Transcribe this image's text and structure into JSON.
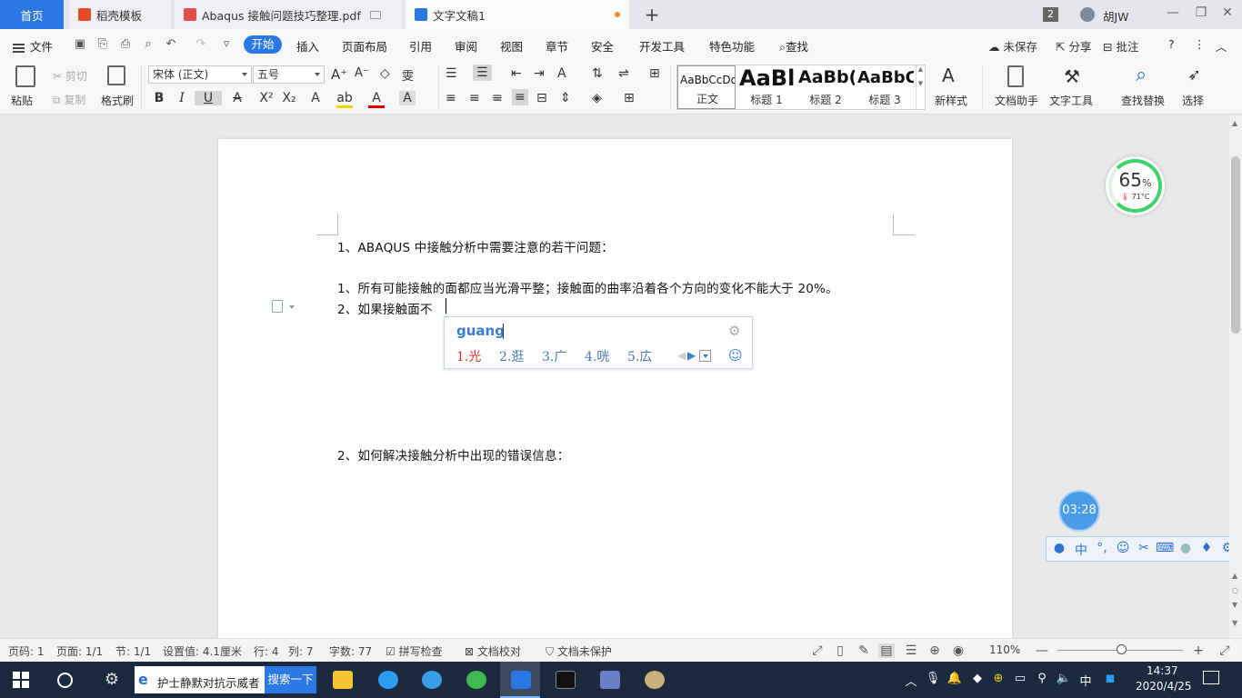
{
  "tabs": {
    "home": "首页",
    "items": [
      {
        "label": "稻壳模板"
      },
      {
        "label": "Abaqus 接触问题技巧整理.pdf"
      },
      {
        "label": "文字文稿1"
      }
    ],
    "add": "+",
    "window_count": "2",
    "user": "胡JW"
  },
  "menu": {
    "file": "文件",
    "items": [
      "开始",
      "插入",
      "页面布局",
      "引用",
      "审阅",
      "视图",
      "章节",
      "安全",
      "开发工具",
      "特色功能"
    ],
    "search": "查找",
    "right": {
      "unsaved": "未保存",
      "share": "分享",
      "comment": "批注"
    }
  },
  "ribbon": {
    "paste": "粘贴",
    "cut": "剪切",
    "copy": "复制",
    "format_painter": "格式刷",
    "font_name": "宋体 (正文)",
    "font_size": "五号",
    "styles": [
      {
        "preview": "AaBbCcDd",
        "label": "正文"
      },
      {
        "preview": "AaBl",
        "label": "标题 1"
      },
      {
        "preview": "AaBb(",
        "label": "标题 2"
      },
      {
        "preview": "AaBbC",
        "label": "标题 3"
      }
    ],
    "new_style": "新样式",
    "doc_assistant": "文档助手",
    "text_tools": "文字工具",
    "find_replace": "查找替换",
    "select": "选择"
  },
  "document": {
    "lines": [
      "1、ABAQUS 中接触分析中需要注意的若干问题：",
      "1、所有可能接触的面都应当光滑平整；接触面的曲率沿着各个方向的变化不能大于 20%。",
      "2、如果接触面不",
      "2、如何解决接触分析中出现的错误信息："
    ]
  },
  "ime": {
    "input": "guang",
    "candidates": [
      "1.光",
      "2.逛",
      "3.广",
      "4.咣",
      "5.広"
    ]
  },
  "widgets": {
    "cpu_percent": "65",
    "cpu_percent_unit": "%",
    "cpu_temp": "71°C",
    "timer": "03:28",
    "ime_mode": "中"
  },
  "status": {
    "page_num": "页码: 1",
    "pages": "页面: 1/1",
    "section": "节: 1/1",
    "setting": "设置值: 4.1厘米",
    "row": "行: 4",
    "col": "列: 7",
    "words": "字数: 77",
    "spell": "拼写检查",
    "proof": "文档校对",
    "protect": "文档未保护",
    "zoom": "110%"
  },
  "taskbar": {
    "search_text": "护士静默对抗示威者",
    "search_button": "搜索一下",
    "tray_ime": "中",
    "time": "14:37",
    "date": "2020/4/25"
  },
  "colors": {
    "accent": "#2b78e4",
    "ime_candidate_first": "#d8322e",
    "cpu_ring": "#3fd16a",
    "taskbar": "#1c2a3e"
  }
}
